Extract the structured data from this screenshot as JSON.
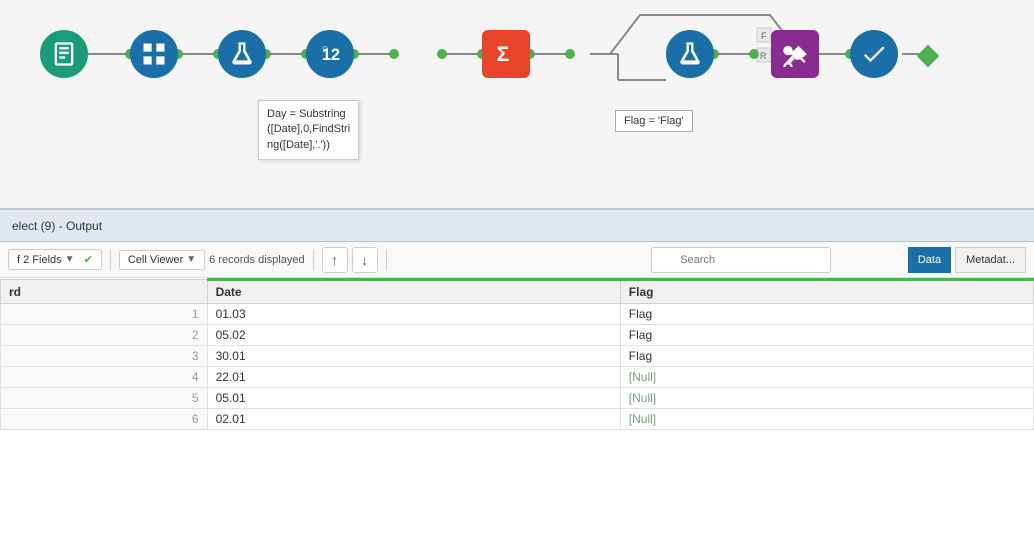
{
  "canvas": {
    "tooltip": {
      "line1": "Day = Substring",
      "line2": "([Date],0,FindStri",
      "line3": "ng([Date],'.'))"
    },
    "flag_label": "Flag = 'Flag'"
  },
  "output": {
    "header_title": "elect (9) - Output",
    "toolbar": {
      "fields_label": "f 2 Fields",
      "cell_viewer_label": "Cell Viewer",
      "records_label": "6 records displayed",
      "search_placeholder": "Search",
      "up_arrow": "↑",
      "down_arrow": "↓",
      "data_tab": "Data",
      "metadata_tab": "Metadat..."
    },
    "table": {
      "columns": [
        "rd",
        "Date",
        "Flag"
      ],
      "rows": [
        {
          "rd": "1",
          "date": "01.03",
          "flag": "Flag",
          "null": false
        },
        {
          "rd": "2",
          "date": "05.02",
          "flag": "Flag",
          "null": false
        },
        {
          "rd": "3",
          "date": "30.01",
          "flag": "Flag",
          "null": false
        },
        {
          "rd": "4",
          "date": "22.01",
          "flag": "[Null]",
          "null": true
        },
        {
          "rd": "5",
          "date": "05.01",
          "flag": "[Null]",
          "null": true
        },
        {
          "rd": "6",
          "date": "02.01",
          "flag": "[Null]",
          "null": true
        }
      ]
    }
  }
}
